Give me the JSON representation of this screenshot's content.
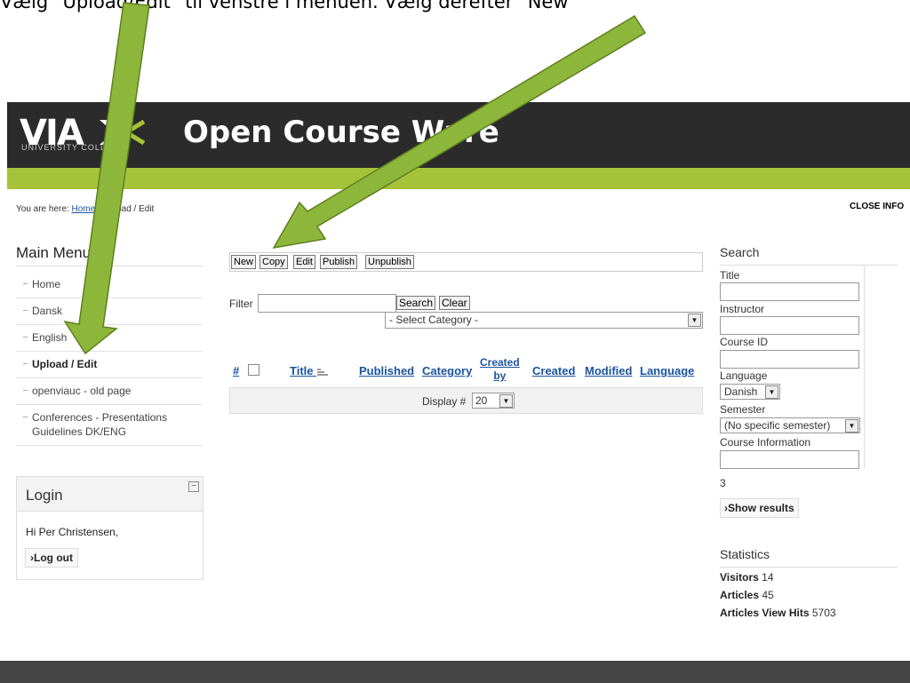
{
  "instruction": "Vælg \"Upload/Edit\" til venstre i menuen. Vælg derefter \"New\"",
  "header": {
    "logo_text": "VIA",
    "logo_sub": "UNIVERSITY COLLEGE",
    "site_title": "Open Course Ware"
  },
  "breadcrumb": {
    "prefix": "You are here:",
    "home": "Home",
    "current": "Upload / Edit"
  },
  "close_info": "CLOSE INFO",
  "main_menu": {
    "title": "Main Menu",
    "items": [
      "Home",
      "Dansk",
      "English",
      "Upload / Edit",
      "openviauc - old page",
      "Conferences - Presentations Guidelines DK/ENG"
    ]
  },
  "login": {
    "title": "Login",
    "toggle": "−",
    "greeting": "Hi Per Christensen,",
    "logout": "›Log out"
  },
  "toolbar": {
    "new": "New",
    "copy": "Copy",
    "edit": "Edit",
    "publish": "Publish",
    "unpublish": "Unpublish"
  },
  "filter": {
    "label": "Filter",
    "value": "",
    "search": "Search",
    "clear": "Clear",
    "category": "- Select Category -"
  },
  "table": {
    "headers": {
      "num": "#",
      "title": "Title",
      "published": "Published",
      "category": "Category",
      "created_by_1": "Created",
      "created_by_2": "by",
      "created": "Created",
      "modified": "Modified",
      "language": "Language"
    },
    "display_label": "Display #",
    "display_value": "20"
  },
  "search": {
    "title": "Search",
    "labels": {
      "title": "Title",
      "instructor": "Instructor",
      "course_id": "Course ID",
      "language": "Language",
      "semester": "Semester",
      "course_info": "Course Information"
    },
    "language_value": "Danish",
    "semester_value": "(No specific semester)",
    "count": "3",
    "show_results": "›Show results"
  },
  "statistics": {
    "title": "Statistics",
    "visitors_label": "Visitors",
    "visitors": "14",
    "articles_label": "Articles",
    "articles": "45",
    "hits_label": "Articles View Hits",
    "hits": "5703"
  },
  "colors": {
    "header_bg": "#2b2b2b",
    "accent_green": "#a6c238",
    "arrow_green": "#8db73b",
    "link_blue": "#1a55a0",
    "footer_bg": "#444444"
  }
}
